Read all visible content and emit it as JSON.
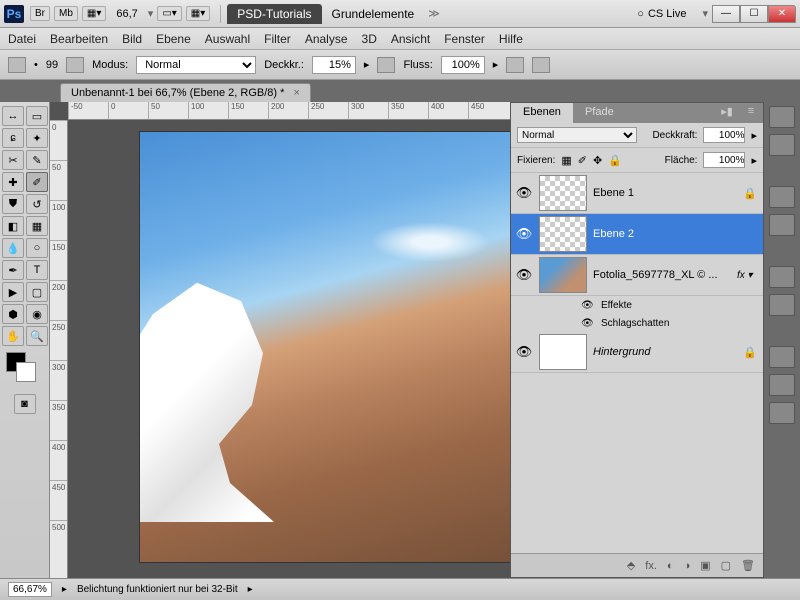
{
  "titlebar": {
    "zoom": "66,7",
    "tab_active": "PSD-Tutorials",
    "tab_inactive": "Grundelemente",
    "cslive": "CS Live"
  },
  "menu": [
    "Datei",
    "Bearbeiten",
    "Bild",
    "Ebene",
    "Auswahl",
    "Filter",
    "Analyse",
    "3D",
    "Ansicht",
    "Fenster",
    "Hilfe"
  ],
  "options": {
    "brush_size": "99",
    "mode_label": "Modus:",
    "mode_value": "Normal",
    "opacity_label": "Deckkr.:",
    "opacity_value": "15%",
    "flow_label": "Fluss:",
    "flow_value": "100%"
  },
  "document": {
    "tab_title": "Unbenannt-1 bei 66,7% (Ebene 2, RGB/8) *"
  },
  "ruler_h": [
    "-50",
    "0",
    "50",
    "100",
    "150",
    "200",
    "250",
    "300",
    "350",
    "400",
    "450"
  ],
  "ruler_v": [
    "0",
    "50",
    "100",
    "150",
    "200",
    "250",
    "300",
    "350",
    "400",
    "450",
    "500"
  ],
  "panels": {
    "tabs": {
      "layers": "Ebenen",
      "paths": "Pfade"
    },
    "blend_mode": "Normal",
    "opacity_label": "Deckkraft:",
    "opacity_value": "100%",
    "lock_label": "Fixieren:",
    "fill_label": "Fläche:",
    "fill_value": "100%",
    "layers": [
      {
        "name": "Ebene 1",
        "locked": true,
        "thumb": "checker"
      },
      {
        "name": "Ebene 2",
        "selected": true,
        "thumb": "checker"
      },
      {
        "name": "Fotolia_5697778_XL © ...",
        "fx": true,
        "thumb": "photo"
      },
      {
        "name": "Hintergrund",
        "locked": true,
        "italic": true,
        "thumb": "white"
      }
    ],
    "effects_label": "Effekte",
    "dropshadow_label": "Schlagschatten"
  },
  "status": {
    "zoom": "66,67%",
    "info": "Belichtung funktioniert nur bei 32-Bit"
  }
}
